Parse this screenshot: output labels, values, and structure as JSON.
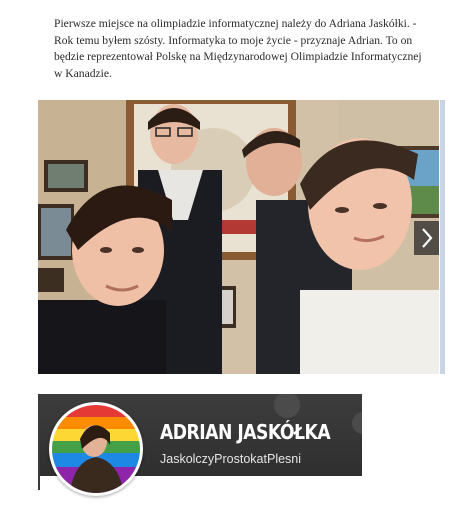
{
  "article": {
    "paragraph": "Pierwsze miejsce na olimpiadzie informatycznej należy do Adriana Jaskółki. - Rok temu byłem szósty. Informatyka to moje życie - przyznaje Adrian. To on będzie reprezentował Polskę na Międzynarodowej Olimpiadzie Informatycznej w Kanadzie."
  },
  "photo": {
    "next_icon": "chevron-right-icon"
  },
  "profile": {
    "name": "ADRIAN JASKÓŁKA",
    "handle": "JaskolczyProstokatPlesni",
    "decoration_icon": "film-reel-icon"
  }
}
